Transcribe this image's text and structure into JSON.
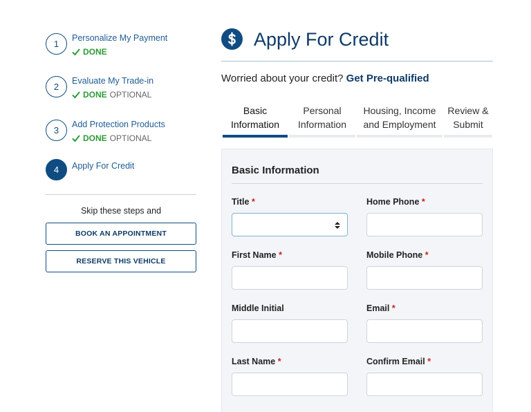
{
  "steps": [
    {
      "number": "1",
      "title": "Personalize My Payment",
      "status": "DONE",
      "optional": ""
    },
    {
      "number": "2",
      "title": "Evaluate My Trade-in",
      "status": "DONE",
      "optional": "OPTIONAL"
    },
    {
      "number": "3",
      "title": "Add Protection Products",
      "status": "DONE",
      "optional": "OPTIONAL"
    },
    {
      "number": "4",
      "title": "Apply For Credit",
      "status": "",
      "optional": ""
    }
  ],
  "sidebar": {
    "skip_text": "Skip these steps and",
    "book_label": "BOOK AN APPOINTMENT",
    "reserve_label": "RESERVE THIS VEHICLE"
  },
  "header": {
    "title": "Apply For Credit",
    "icon": "dollar-icon",
    "worry_text": "Worried about your credit?",
    "prequal_link": "Get Pre-qualified"
  },
  "tabs": [
    {
      "line1": "Basic",
      "line2": "Information",
      "active": true
    },
    {
      "line1": "Personal",
      "line2": "Information",
      "active": false
    },
    {
      "line1": "Housing, Income",
      "line2": "and Employment",
      "active": false
    },
    {
      "line1": "Review &",
      "line2": "Submit",
      "active": false
    }
  ],
  "form": {
    "section_title": "Basic Information",
    "required_mark": "*",
    "fields": {
      "title": {
        "label": "Title",
        "value": ""
      },
      "home_phone": {
        "label": "Home Phone",
        "value": ""
      },
      "first_name": {
        "label": "First Name",
        "value": ""
      },
      "mobile_phone": {
        "label": "Mobile Phone",
        "value": ""
      },
      "middle_initial": {
        "label": "Middle Initial",
        "value": ""
      },
      "email": {
        "label": "Email",
        "value": ""
      },
      "last_name": {
        "label": "Last Name",
        "value": ""
      },
      "confirm_email": {
        "label": "Confirm Email",
        "value": ""
      }
    }
  },
  "colors": {
    "brand": "#0f4c81",
    "done": "#2e9b38",
    "required": "#d11f1f"
  }
}
